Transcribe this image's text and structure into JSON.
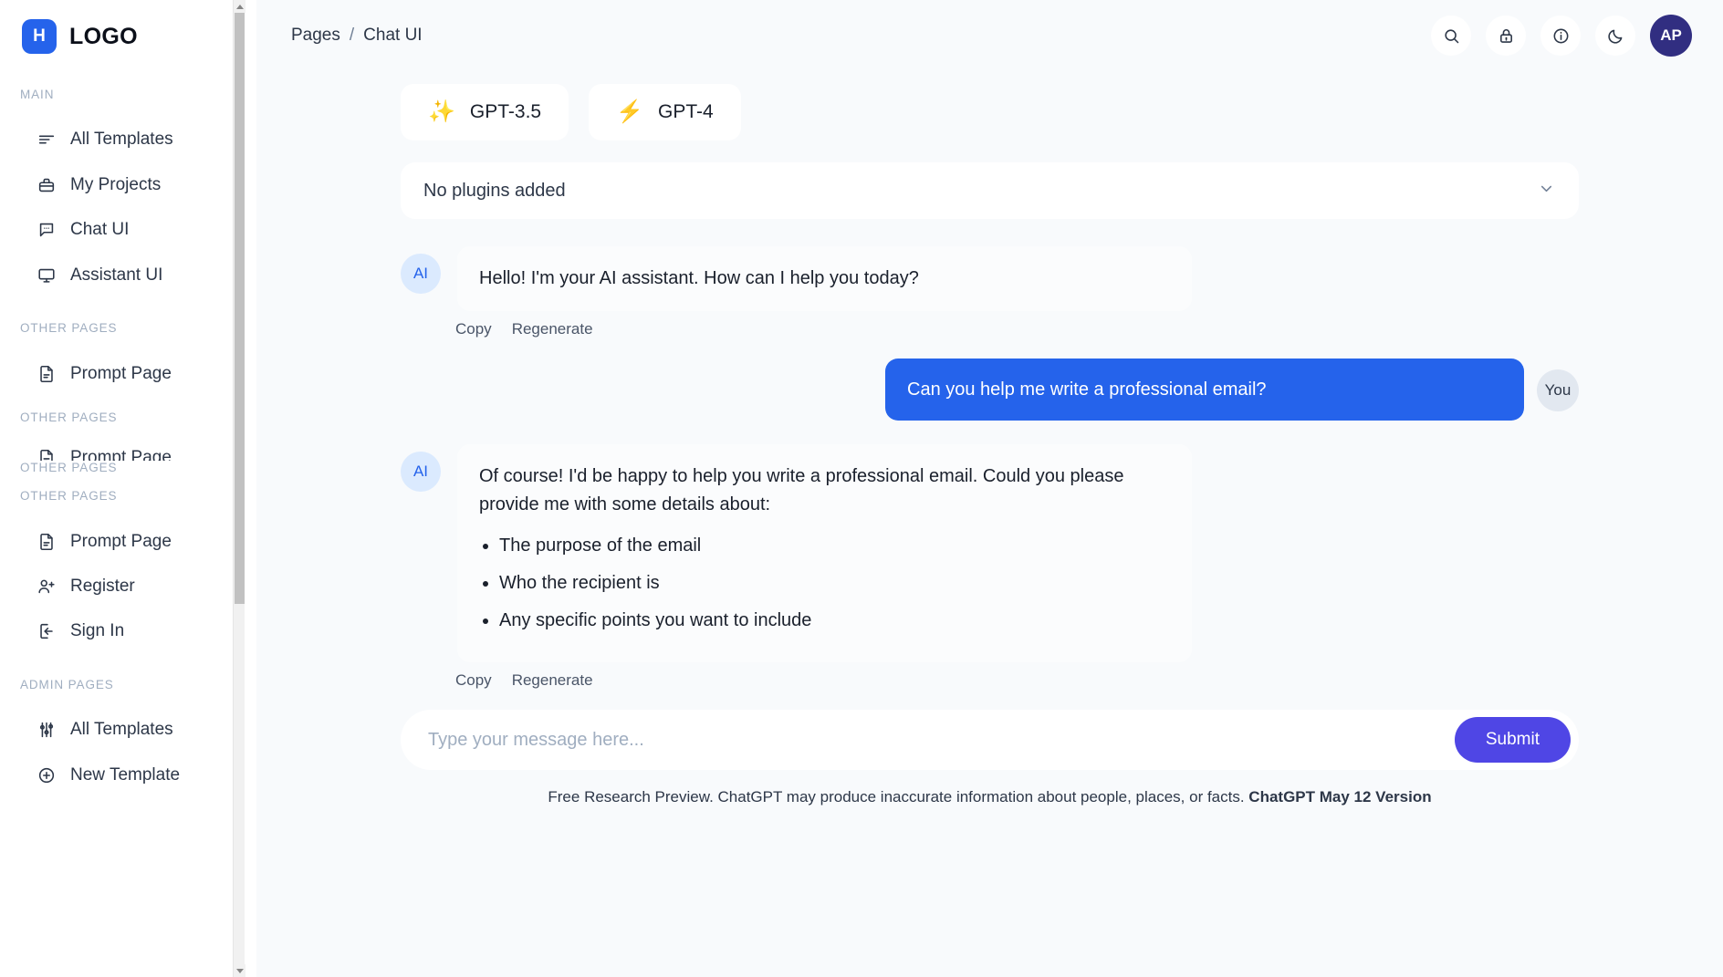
{
  "sidebar": {
    "logo": {
      "badge": "H",
      "text": "LOGO"
    },
    "sections": [
      {
        "header": "MAIN",
        "items": [
          {
            "label": "All Templates",
            "icon": "lines-icon"
          },
          {
            "label": "My Projects",
            "icon": "briefcase-icon"
          },
          {
            "label": "Chat UI",
            "icon": "chat-bubble-icon"
          },
          {
            "label": "Assistant UI",
            "icon": "monitor-icon"
          }
        ]
      },
      {
        "header": "OTHER PAGES",
        "items": [
          {
            "label": "Prompt Page",
            "icon": "document-icon"
          }
        ]
      },
      {
        "header": "OTHER PAGES",
        "items": [
          {
            "label": "Prompt Page",
            "icon": "document-icon"
          }
        ]
      },
      {
        "header": "OTHER PAGES",
        "items": []
      },
      {
        "header": "OTHER PAGES",
        "items": [
          {
            "label": "Prompt Page",
            "icon": "document-icon"
          },
          {
            "label": "Register",
            "icon": "user-plus-icon"
          },
          {
            "label": "Sign In",
            "icon": "sign-in-icon"
          }
        ]
      },
      {
        "header": "ADMIN PAGES",
        "items": [
          {
            "label": "All Templates",
            "icon": "sliders-icon"
          },
          {
            "label": "New Template",
            "icon": "plus-circle-icon"
          }
        ]
      }
    ]
  },
  "topbar": {
    "breadcrumb": {
      "parent": "Pages",
      "separator": "/",
      "current": "Chat UI"
    },
    "icons": [
      {
        "name": "search-icon",
        "label": "Search"
      },
      {
        "name": "lock-icon",
        "label": "Lock"
      },
      {
        "name": "info-icon",
        "label": "Information"
      },
      {
        "name": "moon-icon",
        "label": "Dark mode"
      }
    ],
    "avatar": {
      "initials": "AP",
      "color": "#312e81"
    }
  },
  "main": {
    "models": [
      {
        "label": "GPT-3.5",
        "emoji": "✨"
      },
      {
        "label": "GPT-4",
        "emoji": "⚡"
      }
    ],
    "plugins": {
      "label": "No plugins added"
    },
    "messages": [
      {
        "role": "ai",
        "avatar": "AI",
        "text": "Hello! I'm your AI assistant. How can I help you today?",
        "actions": {
          "copy": "Copy",
          "regenerate": "Regenerate"
        }
      },
      {
        "role": "user",
        "avatar": "You",
        "text": "Can you help me write a professional email?"
      },
      {
        "role": "ai",
        "avatar": "AI",
        "text": "Of course! I'd be happy to help you write a professional email. Could you please provide me with some details about:",
        "bullets": [
          "The purpose of the email",
          "Who the recipient is",
          "Any specific points you want to include"
        ],
        "actions": {
          "copy": "Copy",
          "regenerate": "Regenerate"
        }
      }
    ],
    "composer": {
      "placeholder": "Type your message here...",
      "value": "",
      "submit_label": "Submit"
    },
    "footnote": {
      "text": "Free Research Preview. ChatGPT may produce inaccurate information about people, places, or facts. ",
      "version": "ChatGPT May 12 Version"
    }
  },
  "colors": {
    "brand_blue": "#2563eb",
    "submit_indigo": "#4f46e5",
    "avatar_purple": "#312e81",
    "canvas": "#f8fafc"
  }
}
